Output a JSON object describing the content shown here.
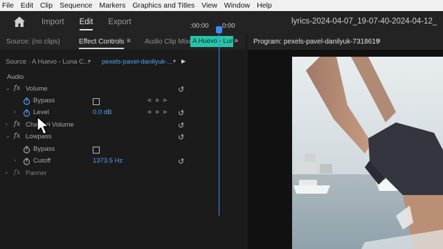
{
  "menubar": [
    "File",
    "Edit",
    "Clip",
    "Sequence",
    "Markers",
    "Graphics and Titles",
    "View",
    "Window",
    "Help"
  ],
  "workspace": {
    "tabs": [
      "Import",
      "Edit",
      "Export"
    ],
    "active": "Edit",
    "window_title": "lyrics-2024-04-07_19-07-40-2024-04-12_"
  },
  "left_panel": {
    "tabs": {
      "source": "Source: (no clips)",
      "effect_controls": "Effect Controls",
      "audio_mixer": "Audio Clip Mixer: pexels-p"
    },
    "menu_icon": "≡",
    "more_icon": "»"
  },
  "effect_controls": {
    "source_label": "Source · A Huevo - Luna C...",
    "clip_label": "pexels-pavel-danilyuk-...",
    "timeline": {
      "ruler_left": ":00:00",
      "ruler_right": "0:00",
      "clip_name": "A Huevo - Luna"
    },
    "sections": {
      "audio": "Audio",
      "volume": "Volume",
      "bypass": "Bypass",
      "level": "Level",
      "level_value": "0.0 dB",
      "channel_volume": "Channel Volume",
      "lowpass": "Lowpass",
      "bypass2": "Bypass",
      "cutoff": "Cutoff",
      "cutoff_value": "1373.5 Hz",
      "panner": "Panner"
    }
  },
  "program_monitor": {
    "title": "Program: pexels-pavel-danilyuk-7318619"
  },
  "colors": {
    "accent_blue": "#4ea4f3",
    "clip_teal": "#27c4a8",
    "playhead": "#3d8df0"
  }
}
